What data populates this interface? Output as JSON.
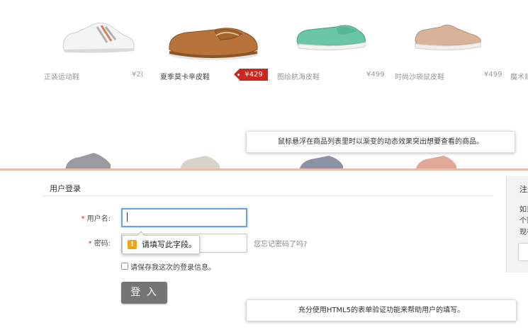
{
  "products": [
    {
      "name": "正装运动鞋",
      "price": "¥2(",
      "active": false
    },
    {
      "name": "夏季莫卡辛皮鞋",
      "price": "¥429",
      "active": true
    },
    {
      "name": "图绘航海皮鞋",
      "price": "¥499",
      "active": false
    },
    {
      "name": "时尚沙袋鼠皮鞋",
      "price": "¥499",
      "active": false
    },
    {
      "name": "魔术贴",
      "price": "",
      "active": false
    }
  ],
  "callouts": {
    "hover_note": "鼠标悬浮在商品列表里时以渐变的动态效果突出想要查看的商品。",
    "form_note": "充分使用HTML5的表单验证功能来帮助用户的填写。"
  },
  "login": {
    "title": "用户登录",
    "username_label": "用户名:",
    "username_value": "",
    "password_label": "密码:",
    "password_value": "",
    "required_mark": "*",
    "forgot_link": "您忘记密码了吗?",
    "validation_message": "请填写此字段。",
    "remember_label": "请保存我这次的登录信息。",
    "remember_checked": false,
    "submit_label": "登 入"
  },
  "side_panel": {
    "title": "注册",
    "lines": [
      "如果",
      "个账",
      "现在"
    ]
  },
  "colors": {
    "price_tag": "#c8281e",
    "divider": "#f0b7ac",
    "focus_border": "#6aa2e0",
    "button": "#757575"
  },
  "icons": {
    "warning": "warning-icon",
    "checkbox": "checkbox-icon"
  }
}
